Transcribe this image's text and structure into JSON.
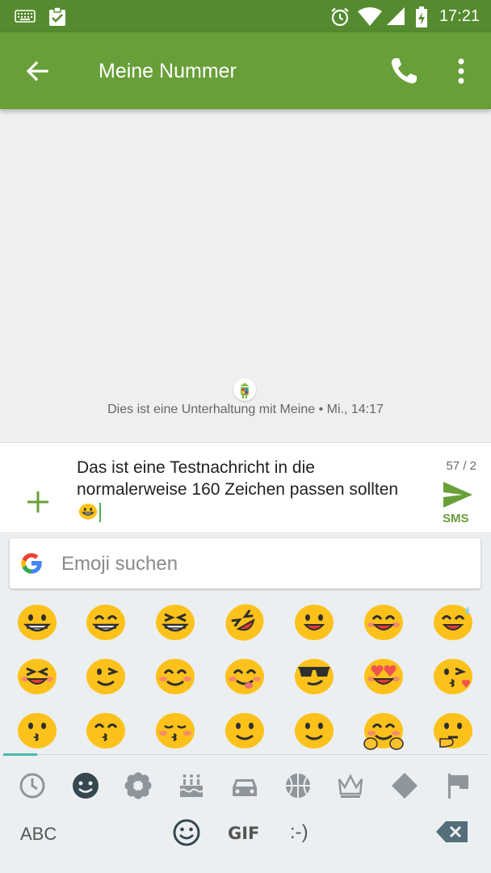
{
  "status_bar": {
    "time": "17:21",
    "icons": [
      "keyboard-icon",
      "clipboard-check-icon",
      "alarm-icon",
      "wifi-icon",
      "signal-icon",
      "battery-charging-icon"
    ]
  },
  "app_bar": {
    "title": "Meine Nummer",
    "icons": [
      "back-arrow-icon",
      "phone-icon",
      "more-vert-icon"
    ],
    "color": "#689f38"
  },
  "conversation": {
    "info": "Dies ist eine Unterhaltung mit Meine • Mi., 14:17"
  },
  "composer": {
    "message": "Das ist eine Testnachricht in die normalerweise 160 Zeichen passen sollten",
    "message_emoji": "grinning-face",
    "char_counter": "57 / 2",
    "send_label": "SMS",
    "accent": "#689f38"
  },
  "keyboard": {
    "search_placeholder": "Emoji suchen",
    "emojis": [
      "grinning-face",
      "grinning-face-with-smiling-eyes",
      "beaming-face",
      "rolling-on-floor-laughing",
      "smiley",
      "smile",
      "grinning-sweat",
      "squinting-laughing",
      "winking-face",
      "smiling-face-with-smiling-eyes",
      "face-savoring-food",
      "smiling-face-with-sunglasses",
      "heart-eyes",
      "face-blowing-kiss",
      "kissing-face",
      "kissing-face-with-smiling-eyes",
      "kissing-face-with-closed-eyes",
      "slightly-smiling-face",
      "slightly-smiling-face",
      "hugging-face",
      "thinking-face"
    ],
    "categories": [
      "recent-icon",
      "smiley-category-icon",
      "flower-icon",
      "cake-icon",
      "car-icon",
      "basketball-icon",
      "crown-icon",
      "diamond-icon",
      "flag-icon"
    ],
    "selected_category": "smiley-category-icon",
    "abc_label": "ABC",
    "gif_label": "GIF",
    "emoticon_label": ":-)",
    "bottom_icons": [
      "emoji-icon",
      "backspace-icon"
    ]
  }
}
